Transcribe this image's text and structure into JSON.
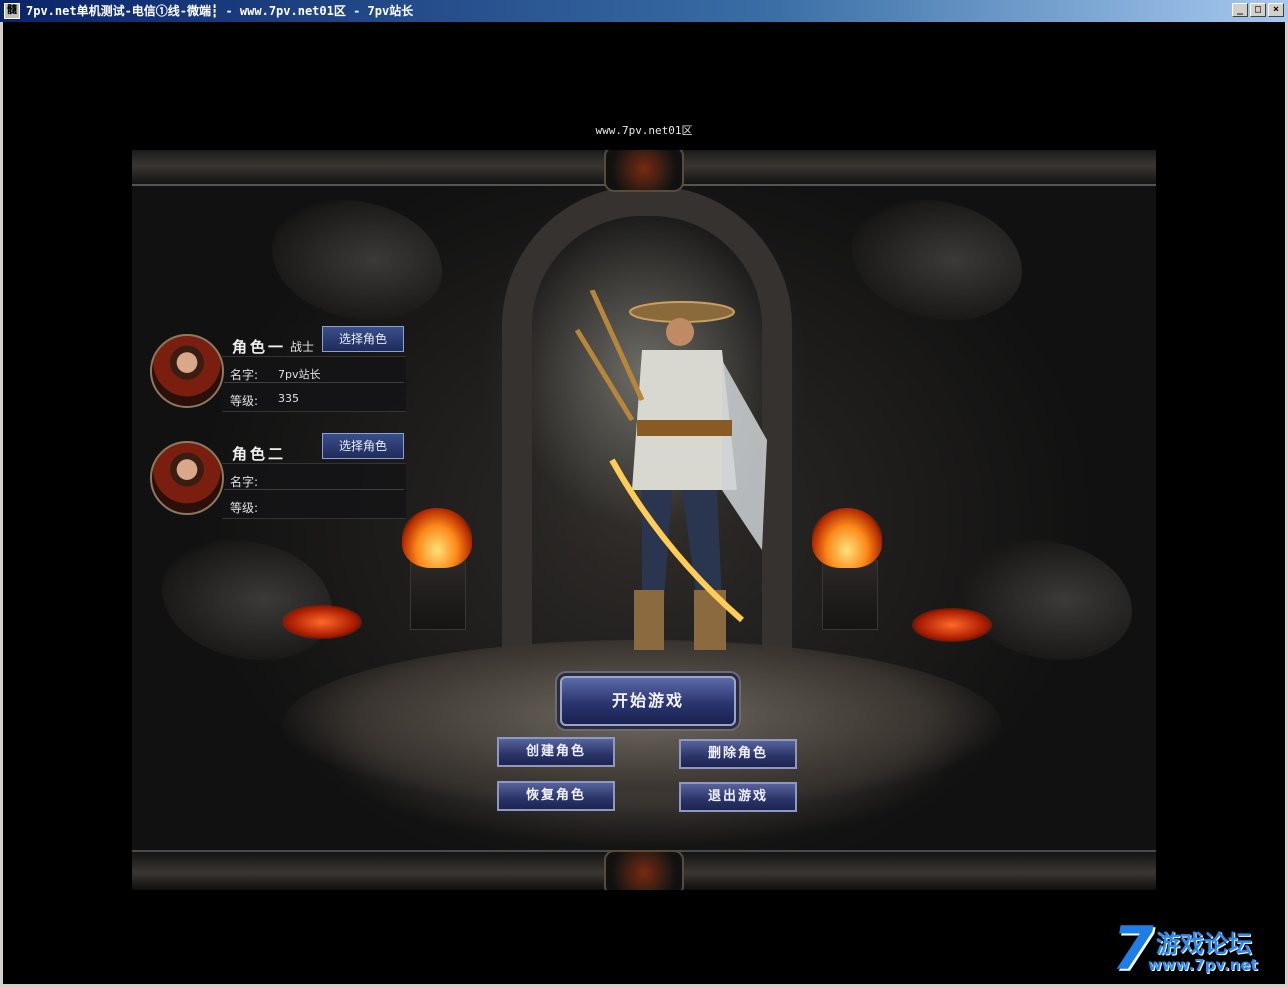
{
  "window": {
    "title": "7pv.net单机测试-电信①线-微端┇ - www.7pv.net01区 - 7pv站长",
    "icon_glyph": "髓",
    "minimize": "_",
    "maximize": "□",
    "close": "×"
  },
  "server_label": "www.7pv.net01区",
  "characters": [
    {
      "slot_title": "角色一",
      "class": "战士",
      "select_label": "选择角色",
      "name_label": "名字:",
      "name": "7pv站长",
      "level_label": "等级:",
      "level": "335"
    },
    {
      "slot_title": "角色二",
      "class": "",
      "select_label": "选择角色",
      "name_label": "名字:",
      "name": "",
      "level_label": "等级:",
      "level": ""
    }
  ],
  "buttons": {
    "start": "开始游戏",
    "create": "创建角色",
    "delete": "删除角色",
    "restore": "恢复角色",
    "exit": "退出游戏"
  },
  "watermark": {
    "seven": "7",
    "text": "游戏论坛",
    "url": "www.7pv.net"
  },
  "colors": {
    "button_blue": "#2a3570",
    "watermark_blue": "#1e7ee8",
    "title_bar": "#0a246a"
  }
}
